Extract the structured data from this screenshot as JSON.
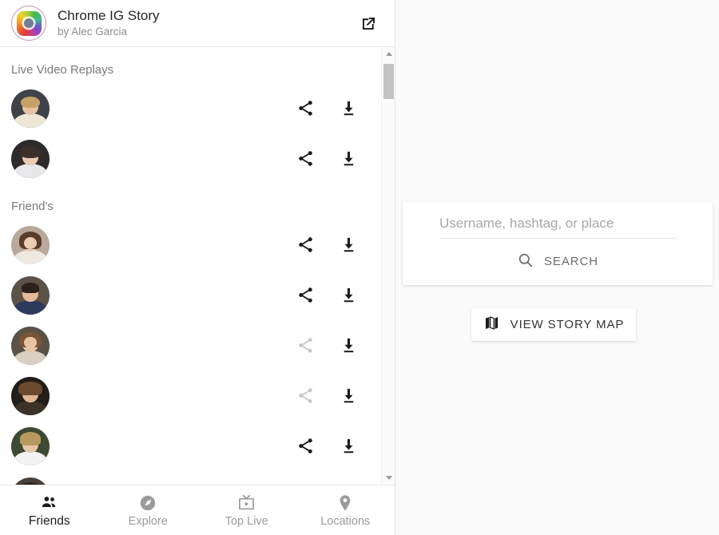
{
  "header": {
    "app_name": "Chrome IG Story",
    "author": "by Alec Garcia",
    "popout_icon": "external-link-icon"
  },
  "sections": [
    {
      "heading": "Live Video Replays",
      "rows": [
        {
          "name": "",
          "share_enabled": true,
          "colors": {
            "bg": "#3f4349",
            "skin": "#e6c2a4",
            "hair": "#c8a069",
            "body": "#efe6d6"
          }
        },
        {
          "name": "",
          "share_enabled": true,
          "colors": {
            "bg": "#2f2b2b",
            "skin": "#e8cbb4",
            "hair": "#3a2f2b",
            "body": "#e8e8ea"
          }
        }
      ]
    },
    {
      "heading": "Friend's",
      "rows": [
        {
          "name": "",
          "share_enabled": true,
          "colors": {
            "bg": "#b9a99b",
            "skin": "#e9cdb4",
            "hair": "#5b3c2b",
            "body": "#efe9e2"
          }
        },
        {
          "name": "",
          "share_enabled": true,
          "colors": {
            "bg": "#5d5248",
            "skin": "#e3bb99",
            "hair": "#2b211a",
            "body": "#2c3a5c"
          }
        },
        {
          "name": "",
          "share_enabled": false,
          "colors": {
            "bg": "#5a5247",
            "skin": "#e7c4a6",
            "hair": "#7c5535",
            "body": "#d9cfc2"
          }
        },
        {
          "name": "",
          "share_enabled": false,
          "colors": {
            "bg": "#221d18",
            "skin": "#e0b694",
            "hair": "#6b4a30",
            "body": "#3c3228"
          }
        },
        {
          "name": "",
          "share_enabled": true,
          "colors": {
            "bg": "#3c4a33",
            "skin": "#e7c6a8",
            "hair": "#b99a5e",
            "body": "#f2f2f2"
          }
        },
        {
          "name": "",
          "share_enabled": true,
          "colors": {
            "bg": "#4a4038",
            "skin": "#e2bd9c",
            "hair": "#33261d",
            "body": "#cfc6ba"
          }
        }
      ]
    }
  ],
  "row_icons": {
    "share": "share-icon",
    "download": "download-icon"
  },
  "scrollbar": {
    "up_icon": "scroll-up-arrow-icon",
    "down_icon": "scroll-down-arrow-icon"
  },
  "bottom_nav": {
    "items": [
      {
        "label": "Friends",
        "icon": "people-icon",
        "active": true
      },
      {
        "label": "Explore",
        "icon": "compass-icon",
        "active": false
      },
      {
        "label": "Top Live",
        "icon": "tv-icon",
        "active": false
      },
      {
        "label": "Locations",
        "icon": "map-pin-icon",
        "active": false
      }
    ]
  },
  "search": {
    "value": "",
    "placeholder": "Username, hashtag, or place",
    "button_label": "SEARCH",
    "button_icon": "search-icon"
  },
  "story_map": {
    "button_label": "VIEW STORY MAP",
    "button_icon": "map-icon"
  },
  "colors": {
    "panel_bg": "#ffffff",
    "page_bg": "#fafafa",
    "text_primary": "#262626",
    "text_muted": "#8e8e8e",
    "icon_active": "#1d1d1d",
    "icon_disabled": "#c9c9c9"
  }
}
